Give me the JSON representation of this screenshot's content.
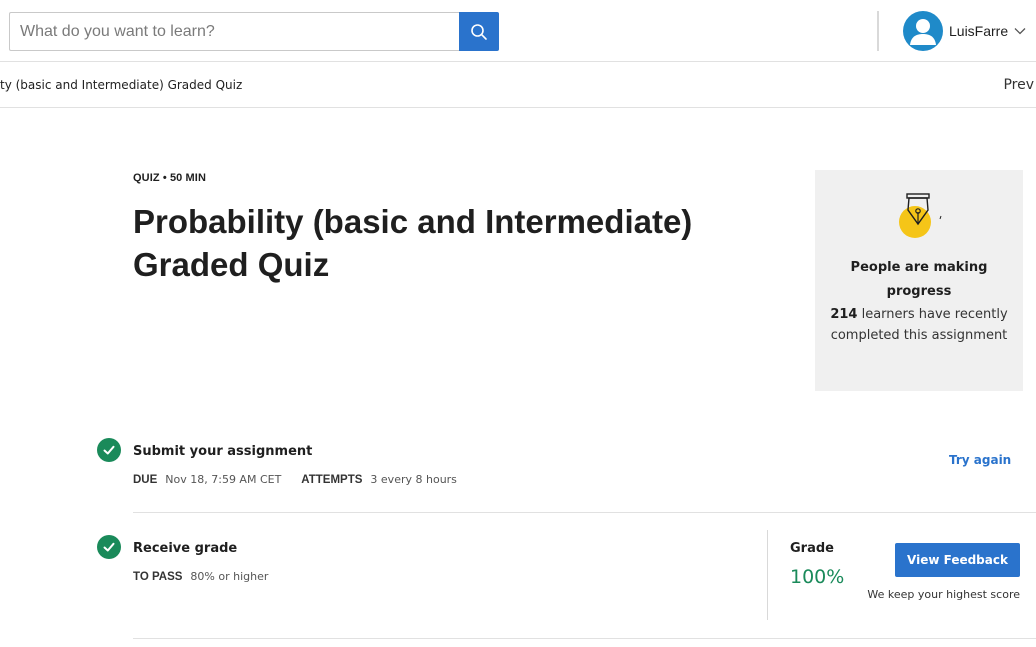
{
  "header": {
    "search": {
      "placeholder": "What do you want to learn?",
      "value": ""
    },
    "user": {
      "name": "LuisFarre"
    }
  },
  "subbar": {
    "breadcrumb": "ty (basic and Intermediate) Graded Quiz",
    "prev_label": "Prev"
  },
  "assignment": {
    "meta": "QUIZ • 50 MIN",
    "title": "Probability (basic and Intermediate) Graded Quiz"
  },
  "progress_card": {
    "heading": "People are making progress",
    "count": "214",
    "text": " learners have recently completed this assignment"
  },
  "steps": {
    "submit": {
      "title": "Submit your assignment",
      "due_label": "DUE",
      "due_value": "Nov 18, 7:59 AM CET",
      "attempts_label": "ATTEMPTS",
      "attempts_value": "3 every 8 hours",
      "action_label": "Try again"
    },
    "grade": {
      "title": "Receive grade",
      "to_pass_label": "TO PASS",
      "to_pass_value": "80% or higher",
      "grade_label": "Grade",
      "grade_value": "100%",
      "feedback_button": "View Feedback",
      "note": "We keep your highest score"
    }
  },
  "colors": {
    "accent": "#2a73cc",
    "success": "#1a8a5a",
    "avatar": "#1f8ac9",
    "card_bg": "#f0f0f0",
    "pen_highlight": "#f5c518"
  },
  "icons": {
    "search": "search-icon",
    "avatar": "user-avatar-icon",
    "chevron": "chevron-down-icon",
    "pen": "pen-nib-icon",
    "check": "check-icon"
  }
}
